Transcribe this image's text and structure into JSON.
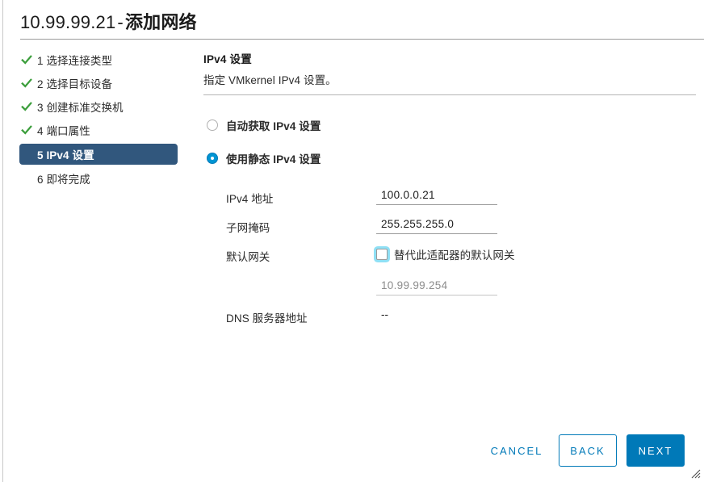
{
  "window": {
    "title_host": "10.99.99.21",
    "title_separator": "-",
    "title_action": "添加网络"
  },
  "steps": [
    {
      "number": "1",
      "label": "1 选择连接类型",
      "state": "done"
    },
    {
      "number": "2",
      "label": "2 选择目标设备",
      "state": "done"
    },
    {
      "number": "3",
      "label": "3 创建标准交换机",
      "state": "done"
    },
    {
      "number": "4",
      "label": "4 端口属性",
      "state": "done"
    },
    {
      "number": "5",
      "label": "5 IPv4 设置",
      "state": "active"
    },
    {
      "number": "6",
      "label": "6 即将完成",
      "state": "pending"
    }
  ],
  "pane": {
    "title": "IPv4 设置",
    "subtitle": "指定 VMkernel IPv4 设置。"
  },
  "ip_mode": {
    "options": [
      {
        "label": "自动获取 IPv4 设置",
        "selected": false
      },
      {
        "label": "使用静态 IPv4 设置",
        "selected": true
      }
    ]
  },
  "form": {
    "ipv4_address": {
      "label": "IPv4 地址",
      "value": "100.0.0.21"
    },
    "subnet_mask": {
      "label": "子网掩码",
      "value": "255.255.255.0"
    },
    "default_gateway": {
      "label": "默认网关",
      "override_checkbox_label": "替代此适配器的默认网关",
      "override_checked": false,
      "gateway_value": "10.99.99.254"
    },
    "dns_servers": {
      "label": "DNS 服务器地址",
      "value": "--"
    }
  },
  "footer": {
    "cancel_label": "CANCEL",
    "back_label": "BACK",
    "next_label": "NEXT"
  },
  "colors": {
    "accent_blue": "#0079b8",
    "radio_blue": "#0095d3",
    "active_step_bg": "#31577d",
    "check_green": "#3c9e3c",
    "focus_ring": "#6ad5f1"
  }
}
